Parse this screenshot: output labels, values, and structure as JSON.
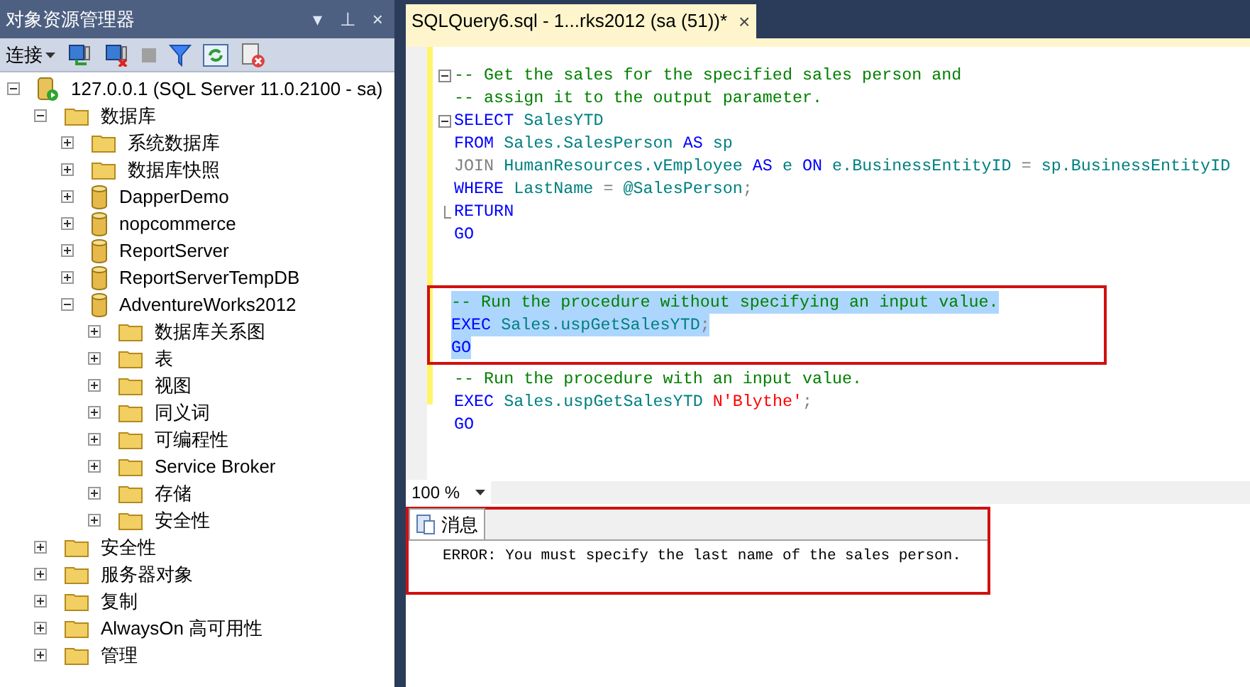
{
  "explorer": {
    "title": "对象资源管理器",
    "title_buttons": [
      "▾",
      "⊥",
      "×"
    ],
    "connect_label": "连接",
    "tree": [
      {
        "label": "127.0.0.1 (SQL Server 11.0.2100 - sa)",
        "kind": "server",
        "expanded": true,
        "children": [
          {
            "label": "数据库",
            "kind": "folder",
            "expanded": true,
            "children": [
              {
                "label": "系统数据库",
                "kind": "folder",
                "expanded": false
              },
              {
                "label": "数据库快照",
                "kind": "folder",
                "expanded": false
              },
              {
                "label": "DapperDemo",
                "kind": "database",
                "expanded": false
              },
              {
                "label": "nopcommerce",
                "kind": "database",
                "expanded": false
              },
              {
                "label": "ReportServer",
                "kind": "database",
                "expanded": false
              },
              {
                "label": "ReportServerTempDB",
                "kind": "database",
                "expanded": false
              },
              {
                "label": "AdventureWorks2012",
                "kind": "database",
                "expanded": true,
                "children": [
                  {
                    "label": "数据库关系图",
                    "kind": "folder",
                    "expanded": false
                  },
                  {
                    "label": "表",
                    "kind": "folder",
                    "expanded": false
                  },
                  {
                    "label": "视图",
                    "kind": "folder",
                    "expanded": false
                  },
                  {
                    "label": "同义词",
                    "kind": "folder",
                    "expanded": false
                  },
                  {
                    "label": "可编程性",
                    "kind": "folder",
                    "expanded": false
                  },
                  {
                    "label": "Service Broker",
                    "kind": "folder",
                    "expanded": false
                  },
                  {
                    "label": "存储",
                    "kind": "folder",
                    "expanded": false
                  },
                  {
                    "label": "安全性",
                    "kind": "folder",
                    "expanded": false
                  }
                ]
              }
            ]
          },
          {
            "label": "安全性",
            "kind": "folder",
            "expanded": false
          },
          {
            "label": "服务器对象",
            "kind": "folder",
            "expanded": false
          },
          {
            "label": "复制",
            "kind": "folder",
            "expanded": false
          },
          {
            "label": "AlwaysOn 高可用性",
            "kind": "folder",
            "expanded": false
          },
          {
            "label": "管理",
            "kind": "folder",
            "expanded": false
          }
        ]
      }
    ]
  },
  "editor": {
    "tab": {
      "title": "SQLQuery6.sql - 1...rks2012 (sa (51))*",
      "close": "×",
      "selected": true
    },
    "blocks": [
      {
        "lines": [
          {
            "kind": "fold-start",
            "selected": false,
            "tokens": [
              {
                "kind": "comment",
                "text": "-- Get the sales for the specified sales person and"
              }
            ]
          },
          {
            "kind": "plain",
            "selected": false,
            "tokens": [
              {
                "kind": "comment",
                "text": "-- assign it to the output parameter."
              }
            ]
          },
          {
            "kind": "fold-start",
            "selected": false,
            "tokens": [
              {
                "kind": "keyword",
                "text": "SELECT"
              },
              {
                "kind": "ident",
                "text": " SalesYTD"
              }
            ]
          },
          {
            "kind": "plain",
            "selected": false,
            "tokens": [
              {
                "kind": "keyword",
                "text": "FROM"
              },
              {
                "kind": "ident",
                "text": " Sales.SalesPerson "
              },
              {
                "kind": "keyword",
                "text": "AS"
              },
              {
                "kind": "ident",
                "text": " sp"
              }
            ]
          },
          {
            "kind": "plain",
            "selected": false,
            "tokens": [
              {
                "kind": "operator",
                "text": "JOIN"
              },
              {
                "kind": "ident",
                "text": " HumanResources.vEmployee "
              },
              {
                "kind": "keyword",
                "text": "AS"
              },
              {
                "kind": "ident",
                "text": " e "
              },
              {
                "kind": "keyword",
                "text": "ON"
              },
              {
                "kind": "ident",
                "text": " e.BusinessEntityID "
              },
              {
                "kind": "operator",
                "text": "="
              },
              {
                "kind": "ident",
                "text": " sp.BusinessEntityID"
              }
            ]
          },
          {
            "kind": "plain",
            "selected": false,
            "tokens": [
              {
                "kind": "keyword",
                "text": "WHERE"
              },
              {
                "kind": "ident",
                "text": " LastName "
              },
              {
                "kind": "operator",
                "text": "="
              },
              {
                "kind": "ident",
                "text": " @SalesPerson"
              },
              {
                "kind": "operator",
                "text": ";"
              }
            ]
          },
          {
            "kind": "fold-end",
            "selected": false,
            "tokens": [
              {
                "kind": "keyword",
                "text": "RETURN"
              }
            ]
          },
          {
            "kind": "plain",
            "selected": false,
            "tokens": [
              {
                "kind": "keyword",
                "text": "GO"
              }
            ]
          }
        ]
      },
      {
        "framed": true,
        "lines": [
          {
            "kind": "plain",
            "selected": true,
            "tokens": [
              {
                "kind": "comment",
                "text": "-- Run the procedure without specifying an input value."
              }
            ]
          },
          {
            "kind": "plain",
            "selected": true,
            "tokens": [
              {
                "kind": "keyword",
                "text": "EXEC"
              },
              {
                "kind": "ident",
                "text": " Sales.uspGetSalesYTD"
              },
              {
                "kind": "operator",
                "text": ";"
              }
            ]
          },
          {
            "kind": "plain",
            "selected": true,
            "tokens": [
              {
                "kind": "keyword",
                "text": "GO"
              }
            ]
          }
        ]
      },
      {
        "lines": [
          {
            "kind": "plain",
            "selected": false,
            "tokens": [
              {
                "kind": "comment",
                "text": "-- Run the procedure with an input value."
              }
            ]
          },
          {
            "kind": "plain",
            "selected": false,
            "tokens": [
              {
                "kind": "keyword",
                "text": "EXEC"
              },
              {
                "kind": "ident",
                "text": " Sales.uspGetSalesYTD "
              },
              {
                "kind": "string",
                "text": "N'Blythe'"
              },
              {
                "kind": "operator",
                "text": ";"
              }
            ]
          },
          {
            "kind": "plain",
            "selected": false,
            "tokens": [
              {
                "kind": "keyword",
                "text": "GO"
              }
            ]
          }
        ]
      }
    ],
    "zoom": "100 %"
  },
  "results": {
    "framed": true,
    "tab": {
      "label": "消息",
      "selected": true
    },
    "message": "ERROR: You must specify the last name of the sales person."
  }
}
